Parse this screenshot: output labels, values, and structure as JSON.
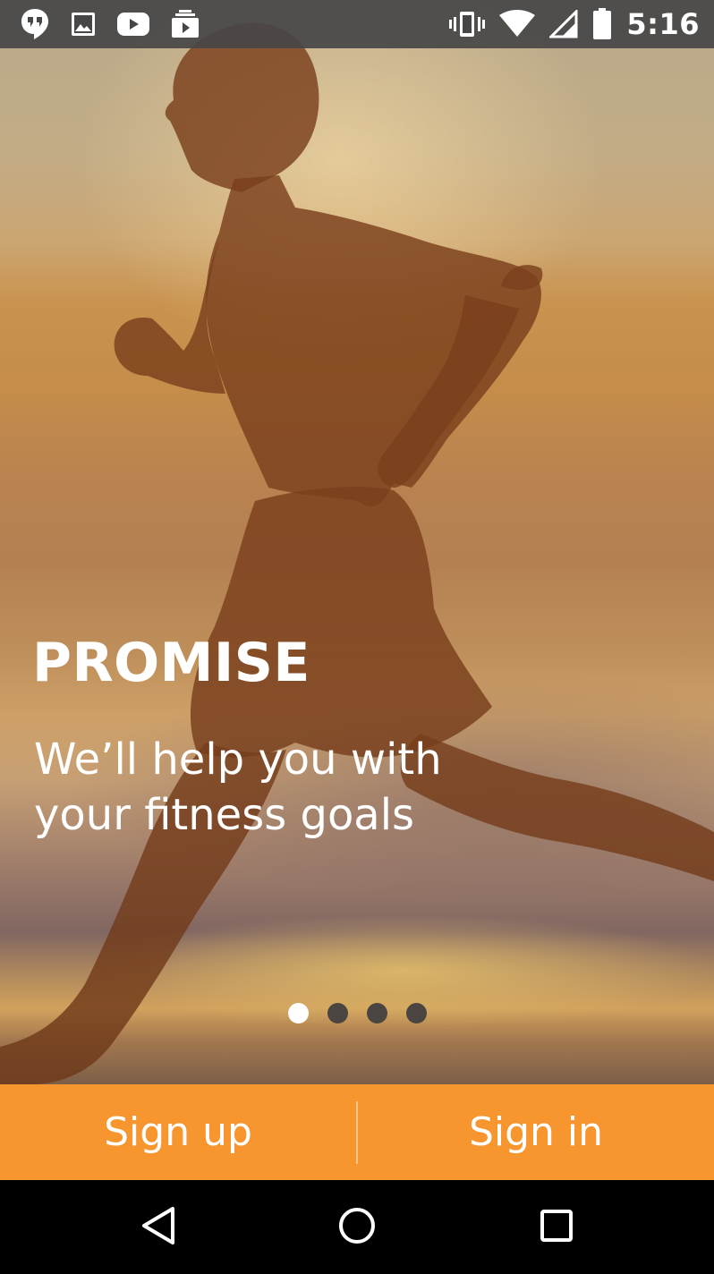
{
  "status_bar": {
    "time": "5:16",
    "left_icons": [
      "hangouts-icon",
      "image-icon",
      "youtube-icon",
      "video-library-icon"
    ],
    "right_icons": [
      "vibrate-icon",
      "wifi-icon",
      "signal-icon",
      "battery-icon"
    ]
  },
  "hero": {
    "headline": "PROMISE",
    "subtitle": "We’ll help you with your fitness goals",
    "pages_total": 4,
    "active_page": 1
  },
  "actions": {
    "sign_up_label": "Sign up",
    "sign_in_label": "Sign in",
    "accent_color": "#f7952e"
  },
  "nav_bar": {
    "buttons": [
      "back-icon",
      "home-icon",
      "recents-icon"
    ]
  }
}
